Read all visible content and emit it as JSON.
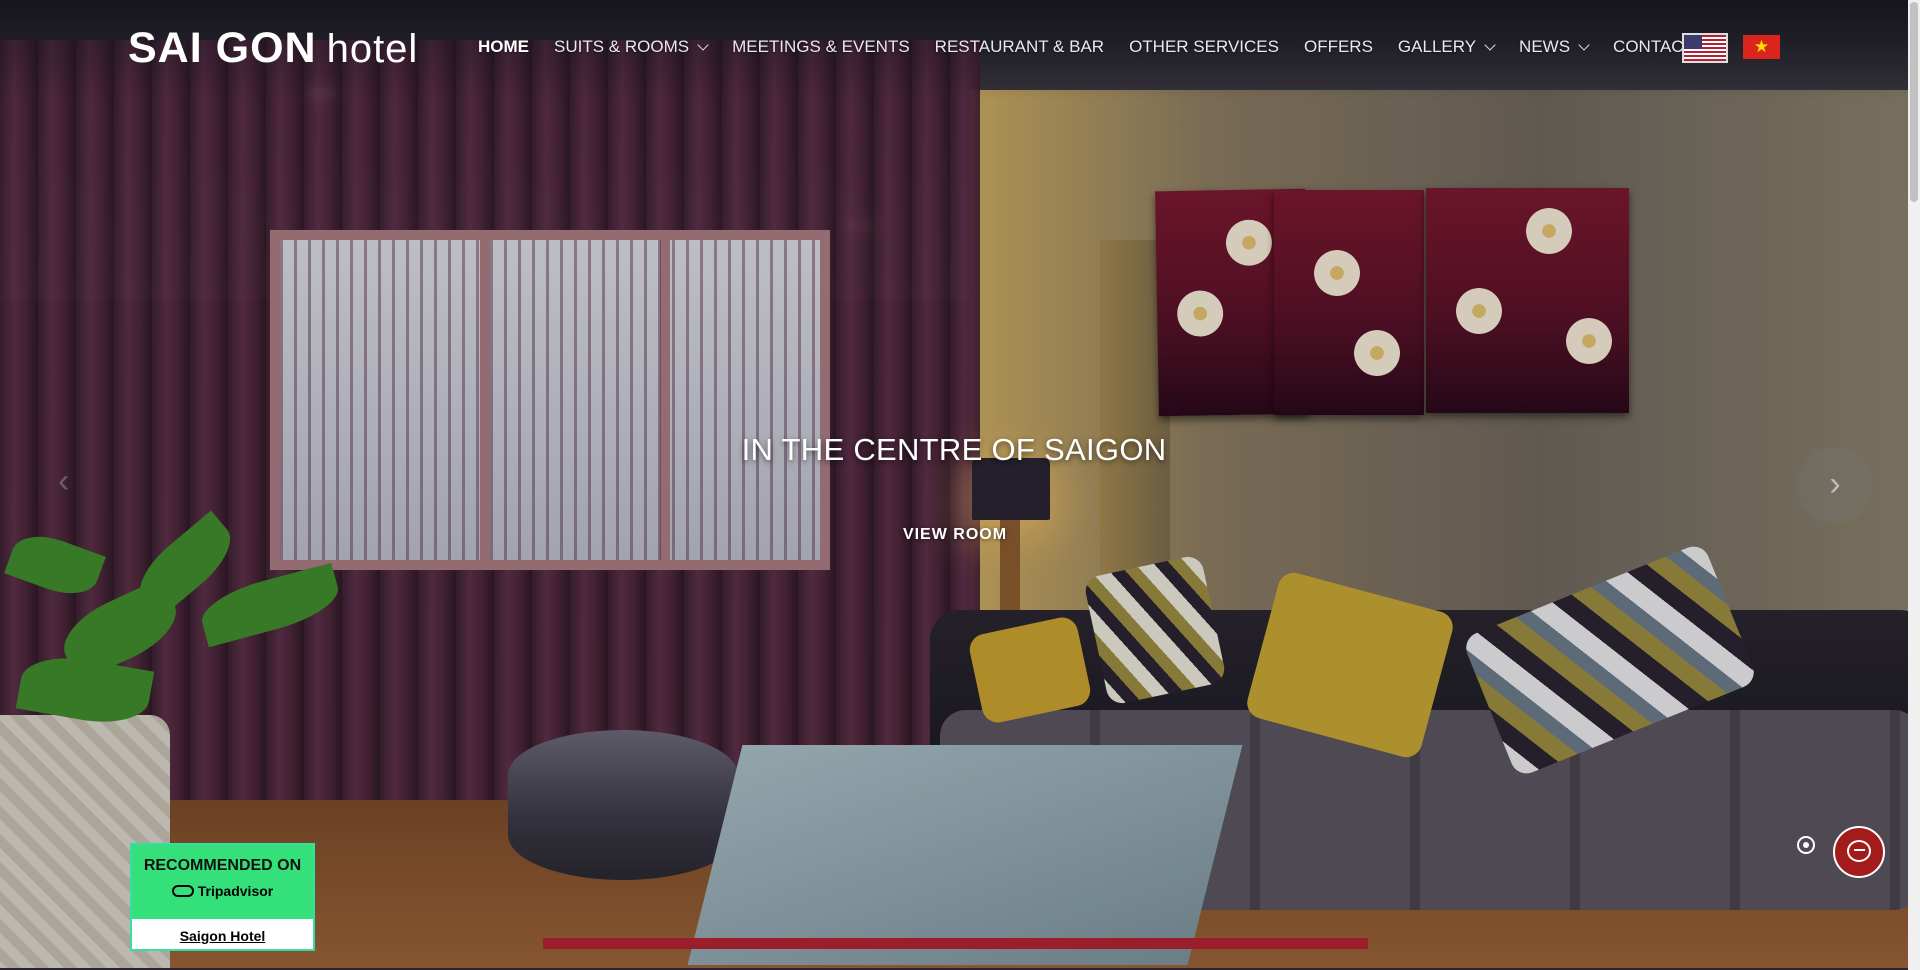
{
  "logo": {
    "part1": "SAI GON",
    "part2": "hotel"
  },
  "nav": {
    "items": [
      {
        "label": "HOME",
        "active": true,
        "dropdown": false
      },
      {
        "label": "SUITS & ROOMS",
        "active": false,
        "dropdown": true
      },
      {
        "label": "MEETINGS & EVENTS",
        "active": false,
        "dropdown": false
      },
      {
        "label": "RESTAURANT & BAR",
        "active": false,
        "dropdown": false
      },
      {
        "label": "OTHER SERVICES",
        "active": false,
        "dropdown": false
      },
      {
        "label": "OFFERS",
        "active": false,
        "dropdown": false
      },
      {
        "label": "GALLERY",
        "active": false,
        "dropdown": true
      },
      {
        "label": "NEWS",
        "active": false,
        "dropdown": true
      },
      {
        "label": "CONTACT",
        "active": false,
        "dropdown": true
      }
    ],
    "languages": [
      "english-flag-icon",
      "vietnamese-flag-icon"
    ]
  },
  "slide": {
    "title": "IN THE CENTRE OF SAIGON",
    "cta": "VIEW ROOM",
    "prev_icon": "chevron-left-icon",
    "next_icon": "chevron-right-icon"
  },
  "tripadvisor": {
    "recommended": "RECOMMENDED ON",
    "brand": "Tripadvisor",
    "link": "Saigon Hotel"
  },
  "chat": {
    "icon": "chat-bubble-icon",
    "close_icon": "close-circle-icon"
  },
  "colors": {
    "accent": "#9a1e2c",
    "tripadvisor": "#34e07a",
    "chat": "#a41b1b"
  }
}
